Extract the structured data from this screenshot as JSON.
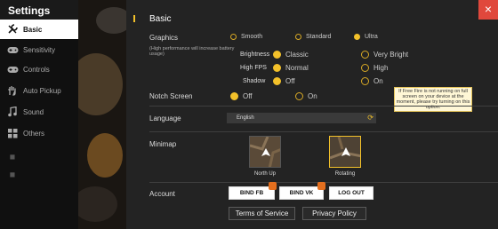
{
  "sidebar": {
    "title": "Settings",
    "items": [
      {
        "label": "Basic",
        "icon": "wrench-icon"
      },
      {
        "label": "Sensitivity",
        "icon": "gamepad-icon"
      },
      {
        "label": "Controls",
        "icon": "gamepad-icon"
      },
      {
        "label": "Auto Pickup",
        "icon": "hand-icon"
      },
      {
        "label": "Sound",
        "icon": "music-note-icon"
      },
      {
        "label": "Others",
        "icon": "grid-icon"
      }
    ]
  },
  "close": {
    "label": "×"
  },
  "section": {
    "title": "Basic"
  },
  "graphics": {
    "label": "Graphics",
    "note": "(High performance will increase battery usage)",
    "options": [
      "Smooth",
      "Standard",
      "Ultra"
    ],
    "selected": "Ultra"
  },
  "brightness": {
    "label": "Brightness",
    "options": [
      "Classic",
      "Very Bright"
    ],
    "selected": "Classic"
  },
  "high_fps": {
    "label": "High FPS",
    "options": [
      "Normal",
      "High"
    ],
    "selected": "Normal"
  },
  "shadow": {
    "label": "Shadow",
    "options": [
      "Off",
      "On"
    ],
    "selected": "Off"
  },
  "notch": {
    "label": "Notch Screen",
    "options": [
      "Off",
      "On"
    ],
    "selected": "Off"
  },
  "tooltip": {
    "text": "If Free Fire is not running on full screen on your device at the moment, please try turning on this option."
  },
  "language": {
    "label": "Language",
    "value": "English"
  },
  "minimap": {
    "label": "Minimap",
    "options": [
      "North Up",
      "Rotating"
    ],
    "selected": "Rotating"
  },
  "account": {
    "label": "Account",
    "bind_fb": "BIND FB",
    "bind_vk": "BIND VK",
    "logout": "LOG OUT",
    "terms": "Terms of Service",
    "privacy": "Privacy Policy"
  },
  "colors": {
    "accent": "#f3c12a",
    "close": "#e0483c",
    "panel": "#232323"
  }
}
